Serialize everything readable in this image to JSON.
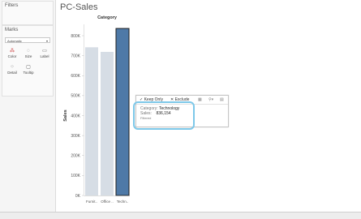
{
  "left_pane": {
    "filters_title": "Filters",
    "marks_title": "Marks",
    "mark_type": "Automatic",
    "buttons": [
      {
        "label": "Color",
        "icon": "color-palette-icon"
      },
      {
        "label": "Size",
        "icon": "size-icon"
      },
      {
        "label": "Label",
        "icon": "label-icon"
      },
      {
        "label": "Detail",
        "icon": "detail-icon"
      },
      {
        "label": "Tooltip",
        "icon": "tooltip-icon"
      }
    ]
  },
  "sheet": {
    "title": "PC-Sales"
  },
  "chart_data": {
    "type": "bar",
    "column_header": "Category",
    "categories": [
      "Furnit..",
      "Office ..",
      "Techn.."
    ],
    "values": [
      742000,
      719000,
      836154
    ],
    "ylabel": "Sales",
    "ylim": [
      0,
      800000
    ],
    "yticks": [
      "0K",
      "100K",
      "200K",
      "300K",
      "400K",
      "500K",
      "600K",
      "700K",
      "800K"
    ],
    "selected_index": 2,
    "colors": {
      "bar": "#d6dde5",
      "selected": "#4e79a7",
      "selected_border": "#1f1f1f"
    }
  },
  "tooltip": {
    "keep_only": "Keep Only",
    "exclude": "Exclude",
    "category_label": "Category:",
    "category_value": "Technology",
    "sales_label": "Sales:",
    "sales_value": "836,154",
    "filtered_note": "Filtered",
    "highlight_color": "#7dc8e9"
  }
}
